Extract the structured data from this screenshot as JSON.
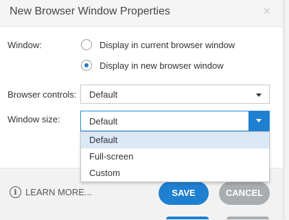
{
  "header": {
    "title": "New Browser Window Properties",
    "close_glyph": "×"
  },
  "window": {
    "label": "Window:",
    "options": [
      {
        "label": "Display in current browser window",
        "selected": false
      },
      {
        "label": "Display in new browser window",
        "selected": true
      }
    ]
  },
  "browser_controls": {
    "label": "Browser controls:",
    "value": "Default"
  },
  "window_size": {
    "label": "Window size:",
    "value": "Default",
    "options": [
      "Default",
      "Full-screen",
      "Custom"
    ],
    "highlighted": "Default"
  },
  "footer": {
    "learn_more": "LEARN MORE...",
    "info_glyph": "i",
    "save": "SAVE",
    "cancel": "CANCEL"
  },
  "colors": {
    "accent": "#1f7fd0",
    "cancel_bg": "#a9adb0",
    "highlight": "#dbe8f6"
  },
  "icons": {
    "close": "close-icon",
    "info": "info-icon",
    "dropdown": "chevron-down-icon"
  }
}
